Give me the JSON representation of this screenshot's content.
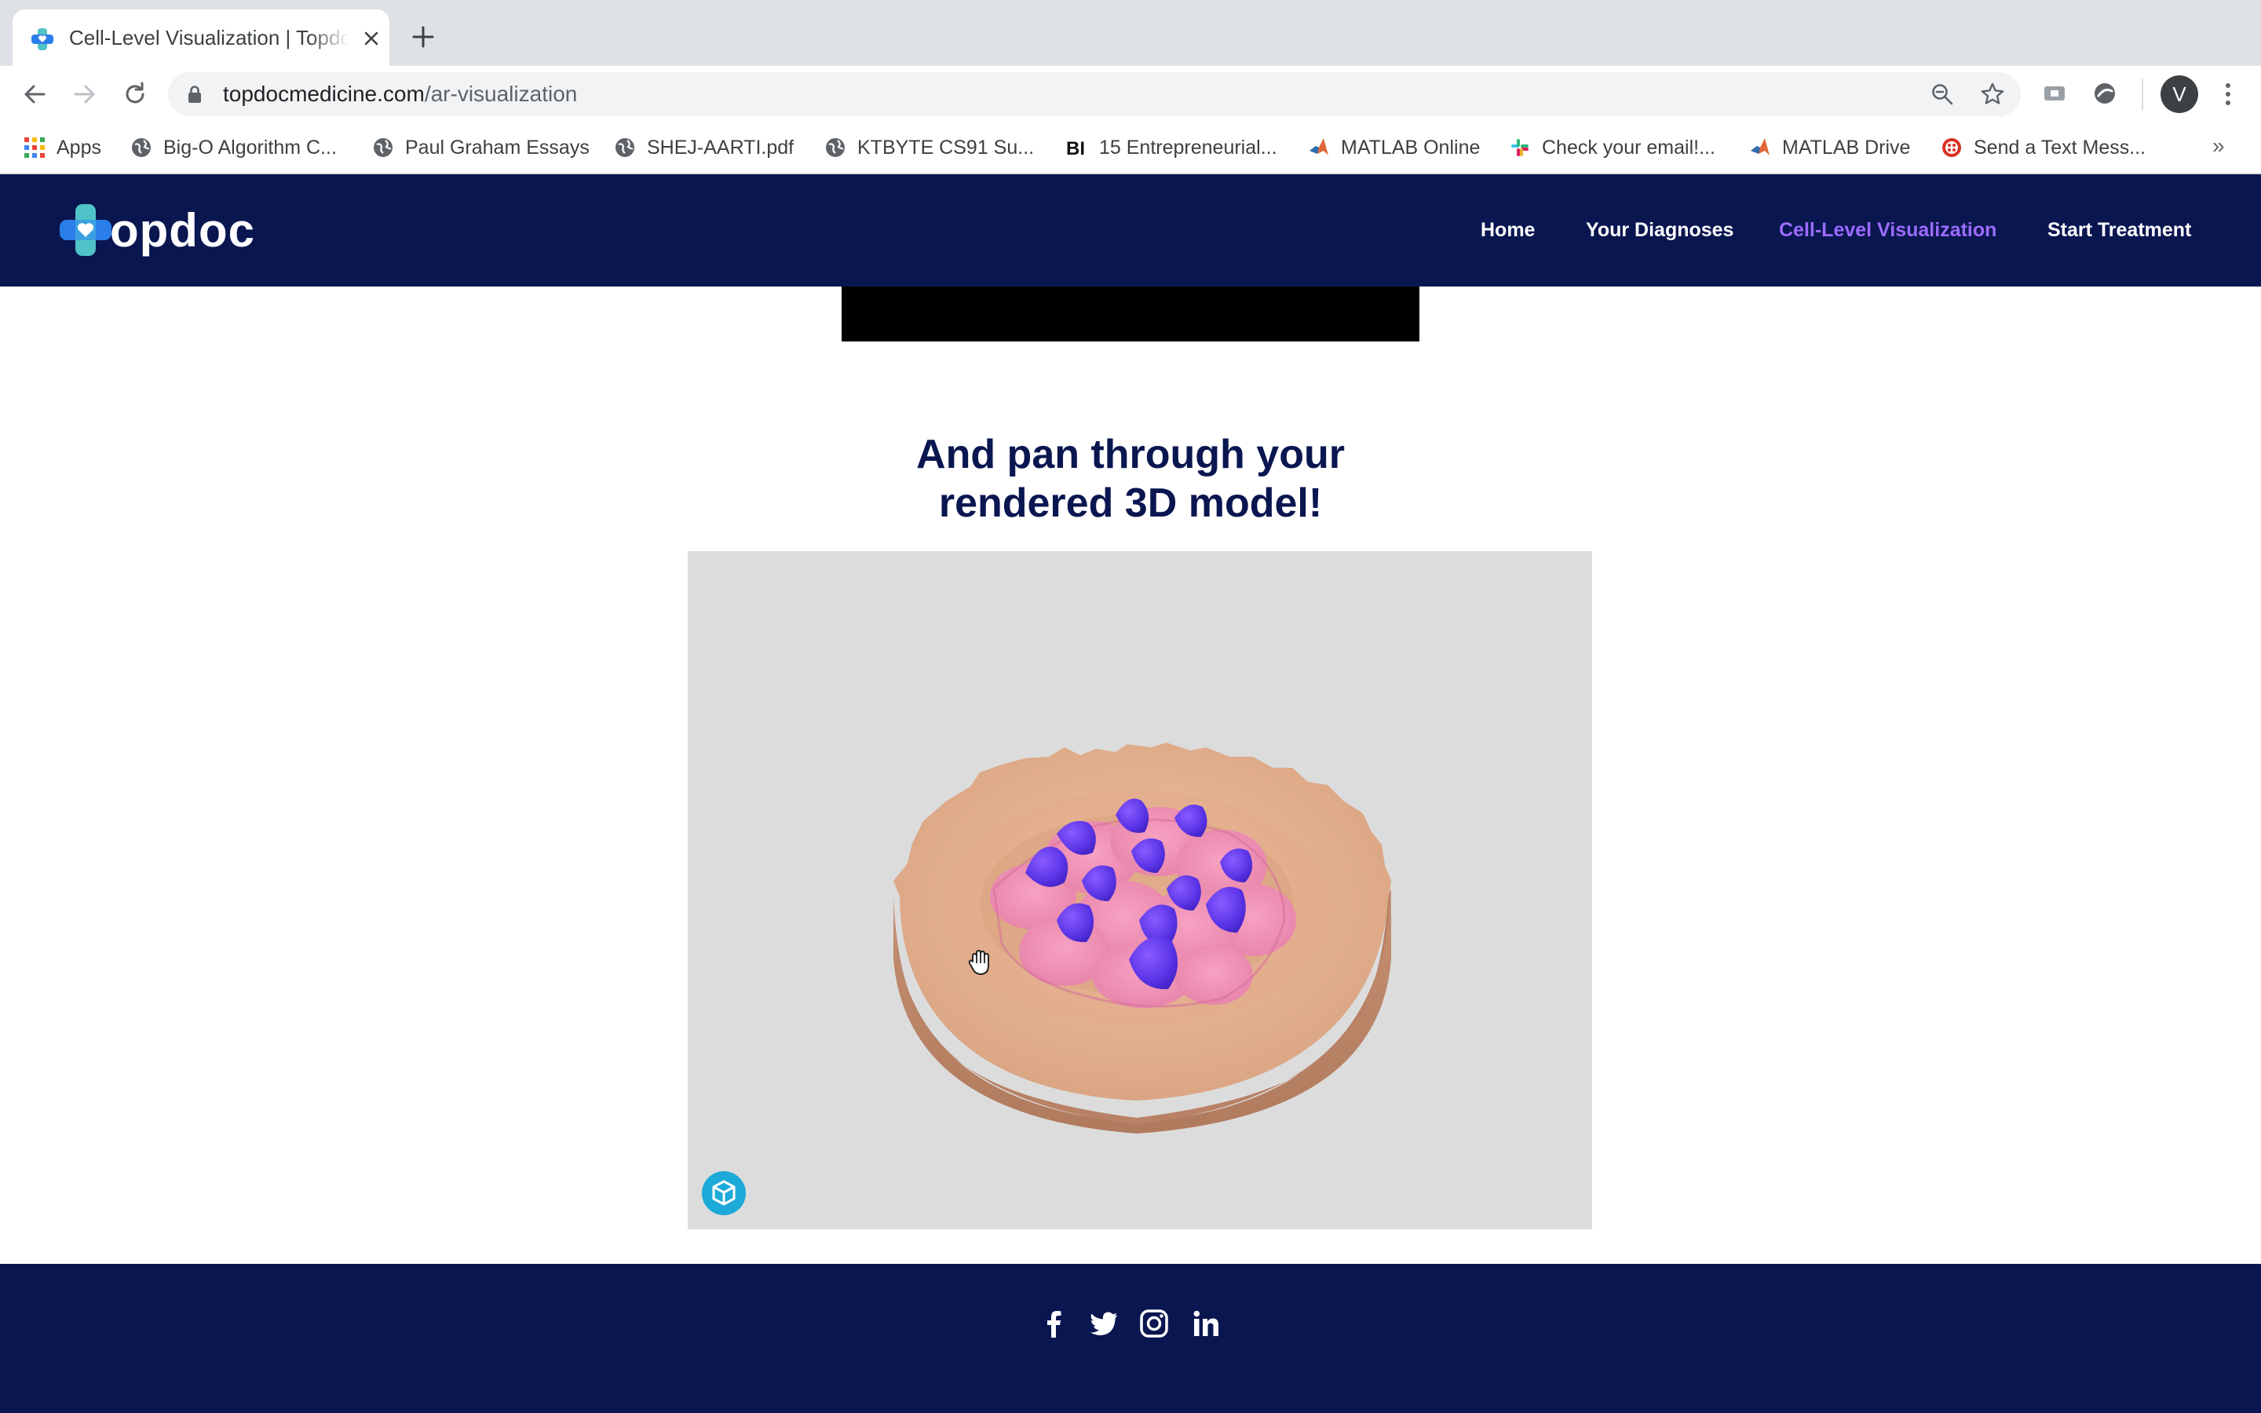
{
  "browser": {
    "tab": {
      "title": "Cell-Level Visualization | Topdoc",
      "favicon": "topdoc-cross-icon"
    },
    "address_bar": {
      "domain": "topdocmedicine.com",
      "path": "/ar-visualization"
    },
    "profile_initial": "V",
    "bookmarks": [
      {
        "label": "Apps",
        "icon": "apps-grid-icon"
      },
      {
        "label": "Big-O Algorithm C...",
        "icon": "globe-icon"
      },
      {
        "label": "Paul Graham Essays",
        "icon": "globe-icon"
      },
      {
        "label": "SHEJ-AARTI.pdf",
        "icon": "globe-icon"
      },
      {
        "label": "KTBYTE CS91 Su...",
        "icon": "globe-icon"
      },
      {
        "label": "15 Entrepreneurial...",
        "icon": "bi-icon"
      },
      {
        "label": "MATLAB Online",
        "icon": "matlab-icon"
      },
      {
        "label": "Check your email!...",
        "icon": "slack-icon"
      },
      {
        "label": "MATLAB Drive",
        "icon": "matlab-icon"
      },
      {
        "label": "Send a Text Mess...",
        "icon": "textmessage-icon"
      }
    ],
    "bookmarks_overflow": "»",
    "colors": {
      "chrome_bg": "#dee1e6",
      "omnibox_bg": "#f1f3f4"
    }
  },
  "site": {
    "logo_text": "opdoc",
    "nav": [
      {
        "label": "Home",
        "active": false
      },
      {
        "label": "Your Diagnoses",
        "active": false
      },
      {
        "label": "Cell-Level Visualization",
        "active": true
      },
      {
        "label": "Start Treatment",
        "active": false
      }
    ],
    "colors": {
      "navy": "#0a1650",
      "nav_active": "#9b6bff",
      "viewer_bg": "#dcdcdc"
    }
  },
  "main": {
    "section_title_line1": "And pan through your",
    "section_title_line2": "rendered 3D model!",
    "viewer": {
      "content": "3d-cell-tissue-model",
      "badge_icon": "sketchfab-icon",
      "cursor_icon": "grab-hand-icon"
    }
  },
  "footer": {
    "social": [
      "facebook-icon",
      "twitter-icon",
      "instagram-icon",
      "linkedin-icon"
    ]
  }
}
